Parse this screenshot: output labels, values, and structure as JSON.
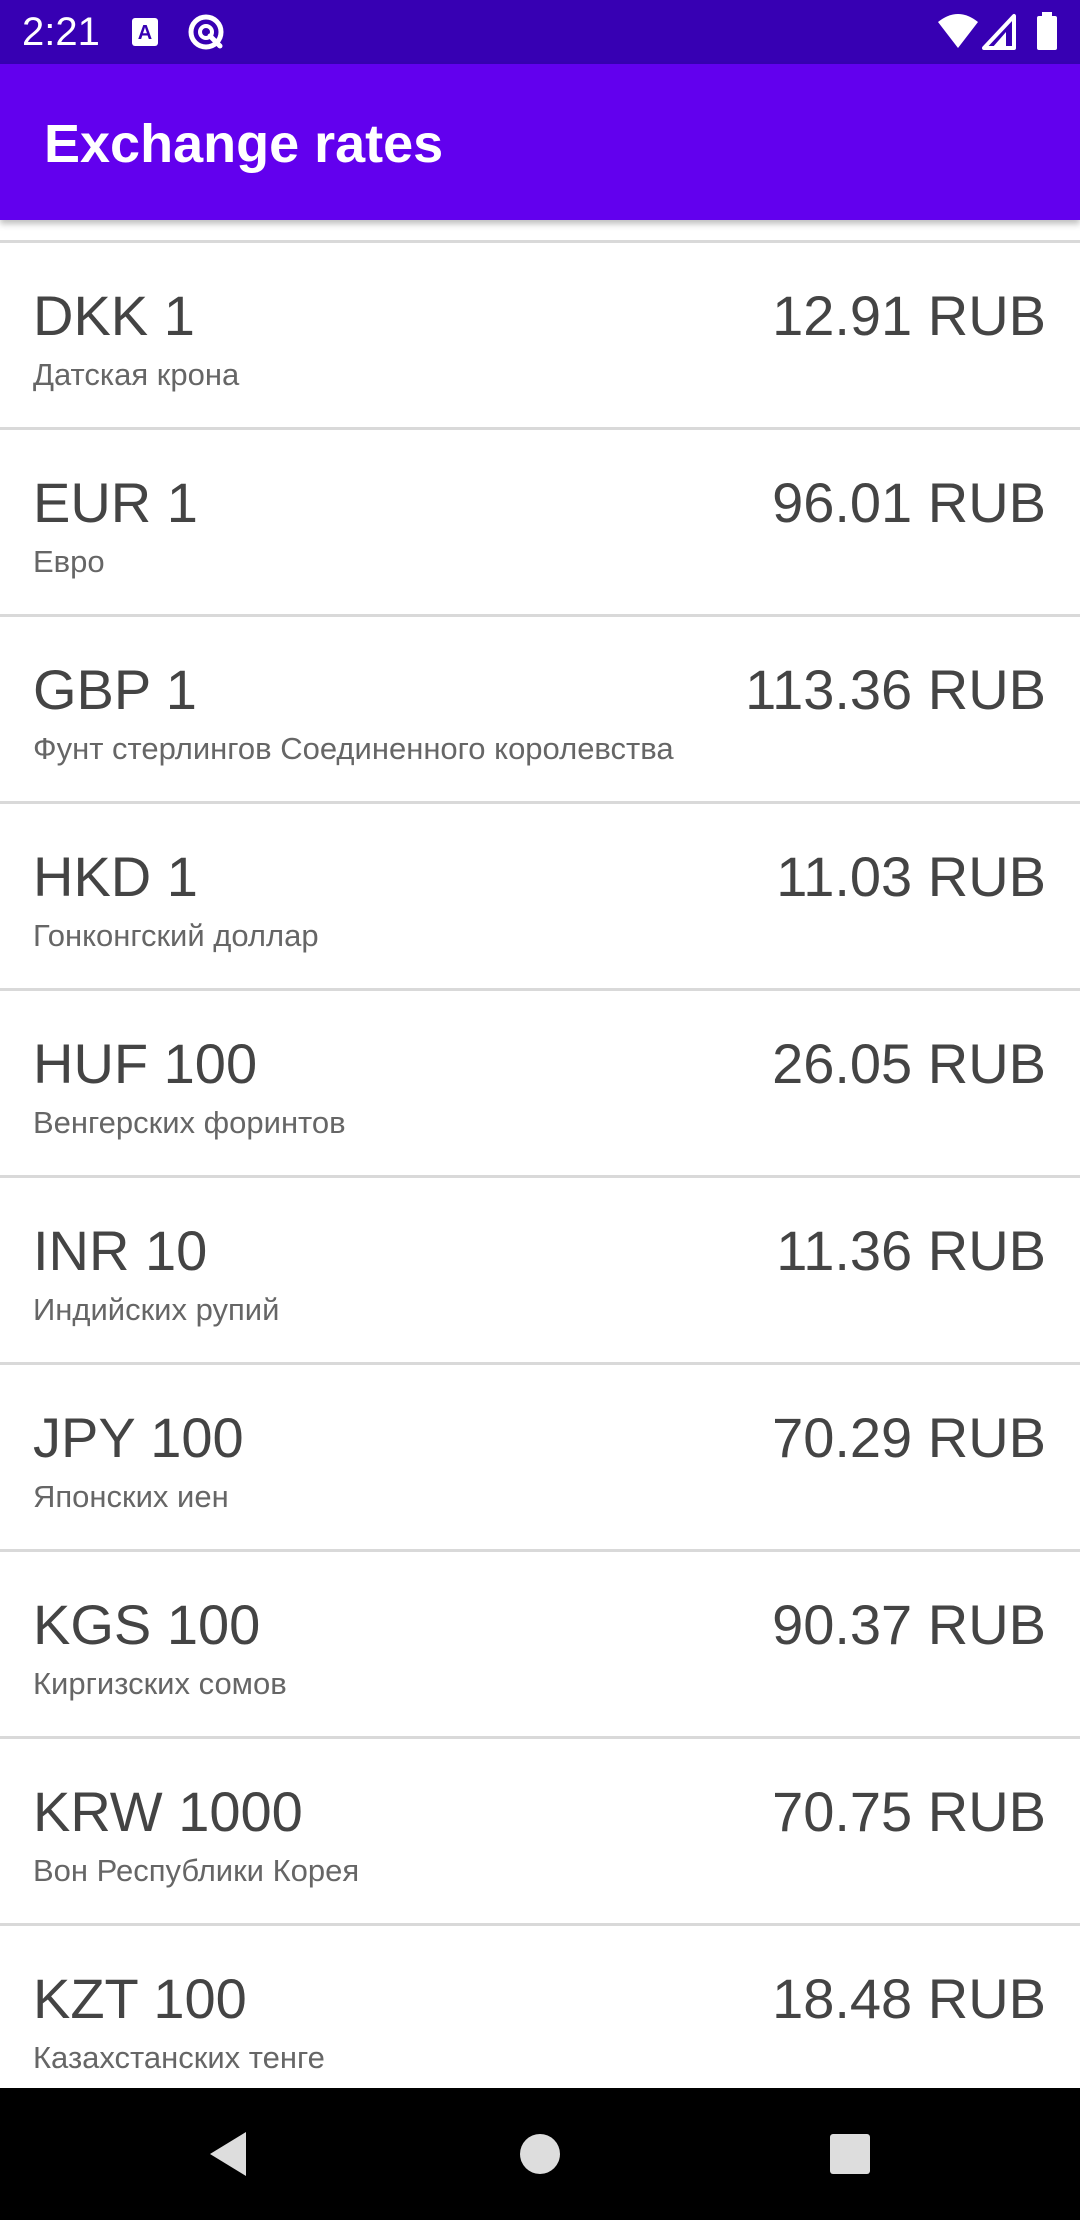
{
  "status_bar": {
    "time": "2:21",
    "icons": [
      "keyboard-a-icon",
      "no-sim-cast-icon",
      "wifi-icon",
      "cell-signal-icon",
      "battery-icon"
    ]
  },
  "app_bar": {
    "title": "Exchange rates"
  },
  "rates": [
    {
      "code": "DKK 1",
      "name": "Датская крона",
      "value": "12.91 RUB"
    },
    {
      "code": "EUR 1",
      "name": "Евро",
      "value": "96.01 RUB"
    },
    {
      "code": "GBP 1",
      "name": "Фунт стерлингов Соединенного королевства",
      "value": "113.36 RUB"
    },
    {
      "code": "HKD 1",
      "name": "Гонконгский доллар",
      "value": "11.03 RUB"
    },
    {
      "code": "HUF 100",
      "name": "Венгерских форинтов",
      "value": "26.05 RUB"
    },
    {
      "code": "INR 10",
      "name": "Индийских рупий",
      "value": "11.36 RUB"
    },
    {
      "code": "JPY 100",
      "name": "Японских иен",
      "value": "70.29 RUB"
    },
    {
      "code": "KGS 100",
      "name": "Киргизских сомов",
      "value": "90.37 RUB"
    },
    {
      "code": "KRW 1000",
      "name": "Вон Республики Корея",
      "value": "70.75 RUB"
    },
    {
      "code": "KZT 100",
      "name": "Казахстанских тенге",
      "value": "18.48 RUB"
    }
  ],
  "nav_bar": {
    "buttons": [
      "back-icon",
      "home-icon",
      "recents-icon"
    ]
  },
  "colors": {
    "status_bar": "#3700b3",
    "app_bar": "#6200ee",
    "text_primary": "#444444",
    "text_secondary": "#666666",
    "divider": "#d9d9d9"
  }
}
